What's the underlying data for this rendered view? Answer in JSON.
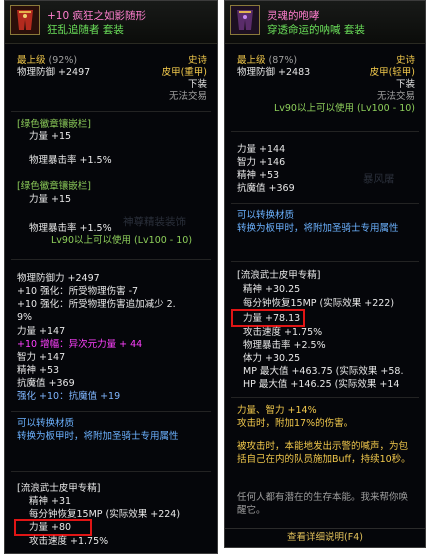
{
  "left": {
    "title": "+10 疯狂之如影随形",
    "subtitle": "狂乱追随者   套装",
    "grade": "最上级",
    "grade_pct": "(92%)",
    "rarity": "史诗",
    "defense": "物理防御 +2497",
    "material": "皮甲(重甲)",
    "slot": "下装",
    "trade": "无法交易",
    "emblem1_title": "[绿色徽章镶嵌栏]",
    "emblem1_a": "力量 +15",
    "emblem1_b": "物理暴击率 +1.5%",
    "emblem2_title": "[绿色徽章镶嵌栏]",
    "emblem2_a": "力量 +15",
    "emblem2_b": "物理暴击率 +1.5%",
    "level_req": "Lv90以上可以使用 (Lv100 - 10)",
    "watermark": "神尊精装装饰",
    "stat_def": "物理防御力 +2497",
    "enh1": "+10 强化：所受物理伤害 -7",
    "enh2": "+10 强化：所受物理伤害追加减少 2.",
    "enh2b": "9%",
    "str": "力量 +147",
    "amp": "+10 增幅：异次元力量 + 44",
    "int": "智力 +147",
    "spi": "精神 +53",
    "magic_res": "抗魔值 +369",
    "reinforce": "强化 +10：抗魔值 +19",
    "transfer_title": "可以转换材质",
    "transfer_desc": "转换为板甲时，将附加圣骑士专用属性",
    "spec_title": "[流浪武士皮甲专精]",
    "spec_spi": "精神 +31",
    "spec_mp": "每分钟恢复15MP (实际效果 +224)",
    "spec_str": "力量 +80",
    "spec_spd": "攻击速度 +1.75%"
  },
  "right": {
    "title": "灵魂的咆哮",
    "subtitle": "穿透命运的呐喊   套装",
    "grade": "最上级",
    "grade_pct": "(87%)",
    "rarity": "史诗",
    "defense": "物理防御 +2483",
    "material": "皮甲(轻甲)",
    "slot": "下装",
    "trade": "无法交易",
    "level_req": "Lv90以上可以使用 (Lv100 - 10)",
    "str": "力量 +144",
    "int": "智力 +146",
    "spi": "精神 +53",
    "magic_res": "抗魔值 +369",
    "watermark": "暴风屠",
    "transfer_title": "可以转换材质",
    "transfer_desc": "转换为板甲时，将附加圣骑士专用属性",
    "spec_title": "[流浪武士皮甲专精]",
    "spec_spi": "精神 +30.25",
    "spec_mp": "每分钟恢复15MP (实际效果 +222)",
    "spec_str": "力量 +78.13",
    "spec_spd": "攻击速度 +1.75%",
    "spec_crit": "物理暴击率 +2.5%",
    "spec_vit": "体力 +30.25",
    "spec_mp_max": "MP 最大值 +463.75 (实际效果 +58.",
    "spec_hp_max": "HP 最大值 +146.25 (实际效果 +14",
    "bonus1": "力量、智力 +14%",
    "bonus2": "攻击时，附加17%的伤害。",
    "passive": "被攻击时，本能地发出示警的喊声，为包括自己在内的队员施加Buff，持续10秒。",
    "lore": "任何人都有潜在的生存本能。我来帮你唤醒它。",
    "detail_button": "查看详细说明(F4)"
  }
}
